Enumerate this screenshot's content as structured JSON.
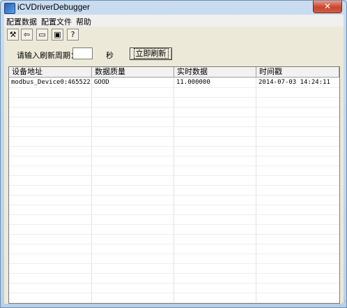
{
  "window": {
    "title": "iCVDriverDebugger",
    "close_glyph": "✕"
  },
  "menu": [
    "配置数据",
    "配置文件",
    "帮助"
  ],
  "toolbar": {
    "buttons": [
      {
        "icon": "tools-icon",
        "glyph": "⚒"
      },
      {
        "icon": "exit-door-icon",
        "glyph": "⇦"
      },
      {
        "icon": "open-folder-icon",
        "glyph": "▭"
      },
      {
        "icon": "save-disk-icon",
        "glyph": "▣"
      },
      {
        "icon": "help-icon",
        "glyph": "?"
      }
    ]
  },
  "refresh": {
    "prompt_label": "请输入刷新周期：",
    "period_value": "",
    "unit_label": "秒",
    "button_label": "立即刷新"
  },
  "table": {
    "columns": [
      "设备地址",
      "数据质量",
      "实时数据",
      "时间戳"
    ],
    "rows": [
      [
        "modbus_Device0:465522",
        "GOOD",
        "11.000000",
        "2014-07-03 14:24:11"
      ]
    ]
  }
}
